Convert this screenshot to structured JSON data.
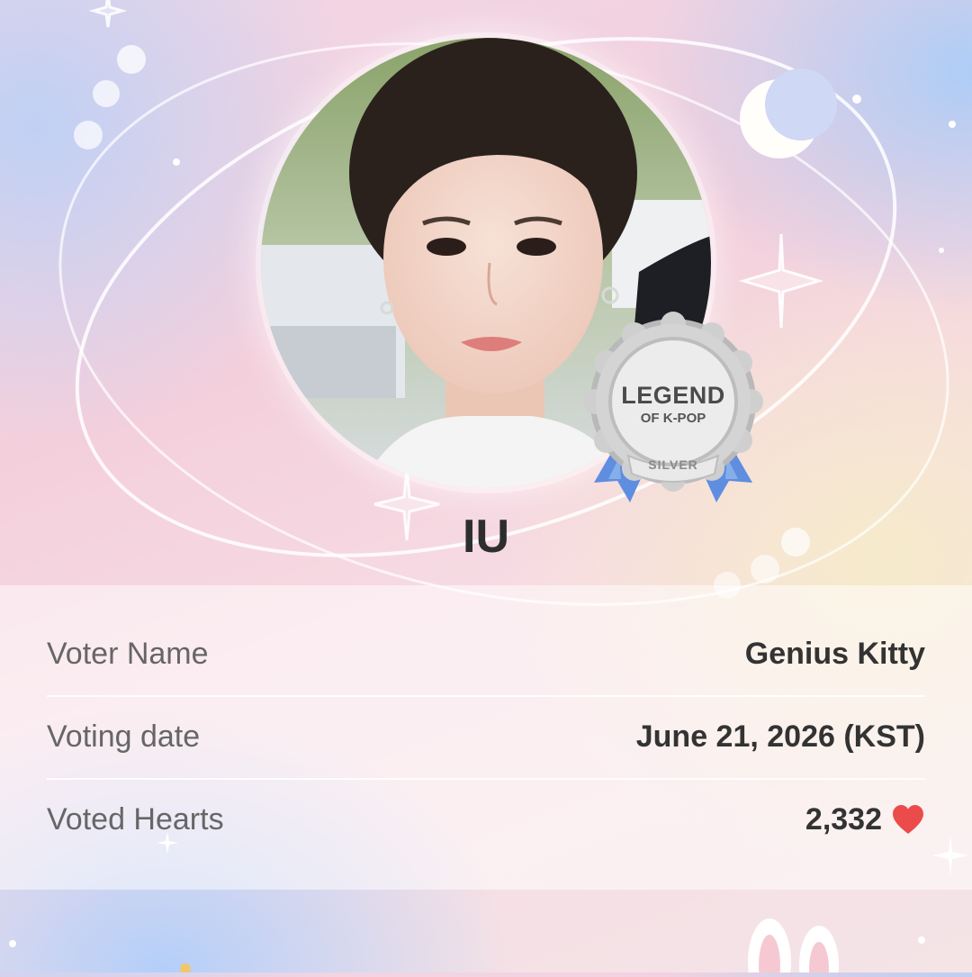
{
  "badge": {
    "title": "LEGEND",
    "subtitle": "OF K-POP",
    "tier": "SILVER"
  },
  "idol": {
    "name": "IU"
  },
  "vote_info": {
    "rows": [
      {
        "label": "Voter Name",
        "value": "Genius Kitty"
      },
      {
        "label": "Voting date",
        "value": "June 21, 2026 (KST)"
      },
      {
        "label": "Voted Hearts",
        "value": "2,332"
      }
    ]
  },
  "icons": {
    "heart": "heart-icon",
    "moon": "crescent-moon-icon",
    "sparkle": "sparkle-icon",
    "badge": "medal-badge-icon",
    "bunny": "bunny-ears-icon"
  },
  "colors": {
    "heart": "#ec4b4b",
    "badge_silver": "#c9c9c9",
    "ribbon_blue": "#5f8ee0"
  }
}
